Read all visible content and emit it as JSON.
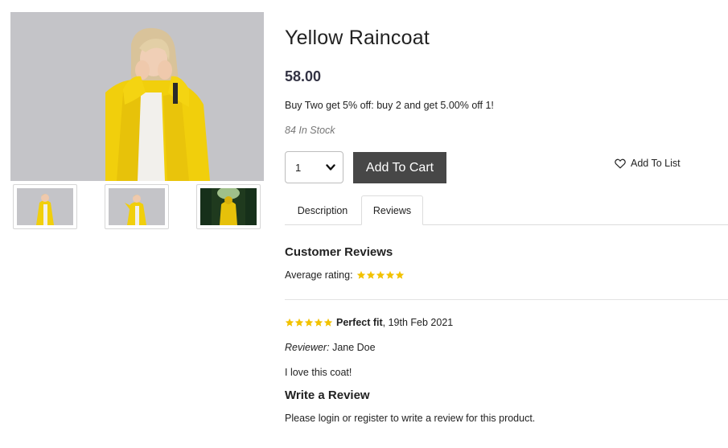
{
  "product": {
    "title": "Yellow Raincoat",
    "price": "58.00",
    "promotion": "Buy Two get 5% off: buy 2 and get 5.00% off 1!",
    "stock": "84 In Stock",
    "quantity_selected": "1",
    "add_to_cart_label": "Add To Cart",
    "add_to_list_label": "Add To List"
  },
  "gallery": {
    "thumbnails": [
      {
        "icon": "product-thumbnail-1"
      },
      {
        "icon": "product-thumbnail-2"
      },
      {
        "icon": "product-thumbnail-3"
      }
    ]
  },
  "tabs": [
    {
      "label": "Description",
      "active": false
    },
    {
      "label": "Reviews",
      "active": true
    }
  ],
  "reviews": {
    "heading": "Customer Reviews",
    "average_label": "Average rating:",
    "average_rating": 5,
    "items": [
      {
        "rating": 5,
        "title": "Perfect fit",
        "date": ", 19th Feb 2021",
        "reviewer_label": "Reviewer:",
        "reviewer_name": "Jane Doe",
        "body": "I love this coat!"
      }
    ],
    "write_heading": "Write a Review",
    "login_prefix": "Please ",
    "login_link": "login",
    "login_mid": " or ",
    "register_link": "register",
    "login_suffix": " to write a review for this product."
  },
  "colors": {
    "star": "#f2c200",
    "button_dark": "#474747",
    "coat_yellow": "#f1cf0c"
  }
}
